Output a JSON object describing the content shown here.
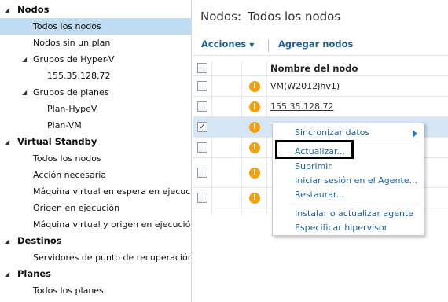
{
  "sidebar": {
    "sections": [
      {
        "label": "Nodos"
      },
      {
        "label": "Virtual Standby"
      },
      {
        "label": "Destinos"
      },
      {
        "label": "Planes"
      }
    ],
    "items": [
      {
        "label": "Todos los nodos"
      },
      {
        "label": "Nodos sin un plan"
      },
      {
        "label": "Grupos de Hyper-V"
      },
      {
        "label": "155.35.128.72"
      },
      {
        "label": "Grupos de planes"
      },
      {
        "label": "Plan-HypeV"
      },
      {
        "label": "Plan-VM"
      },
      {
        "label": "Todos los nodos"
      },
      {
        "label": "Acción necesaria"
      },
      {
        "label": "Máquina virtual en espera en ejecución"
      },
      {
        "label": "Origen en ejecución"
      },
      {
        "label": "Máquina virtual y origen en ejecución"
      },
      {
        "label": "Servidores de punto de recuperación"
      },
      {
        "label": "Todos los planes"
      }
    ]
  },
  "main": {
    "title_part1": "Nodos:",
    "title_part2": "Todos los nodos",
    "toolbar": {
      "actions_label": "Acciones",
      "add_label": "Agregar nodos"
    },
    "column_header": "Nombre del nodo",
    "rows": [
      {
        "name": "VM(W2012Jhv1)",
        "checked": false
      },
      {
        "name": "155.35.128.72",
        "checked": false
      },
      {
        "name": "",
        "checked": true
      },
      {
        "name": "",
        "checked": false
      },
      {
        "name": "",
        "checked": false
      },
      {
        "name": "",
        "checked": false
      }
    ]
  },
  "context_menu": {
    "items": [
      "Sincronizar datos",
      "Actualizar...",
      "Suprimir",
      "Iniciar sesión en el Agente...",
      "Restaurar...",
      "Instalar o actualizar agente",
      "Especificar hipervisor"
    ]
  },
  "icons": {
    "warning": "warning-icon",
    "caret": "caret-down-icon",
    "submenu": "chevron-right-icon"
  },
  "colors": {
    "selection": "#bfdcf2",
    "link": "#1f5f99",
    "warning": "#f2a10c"
  }
}
